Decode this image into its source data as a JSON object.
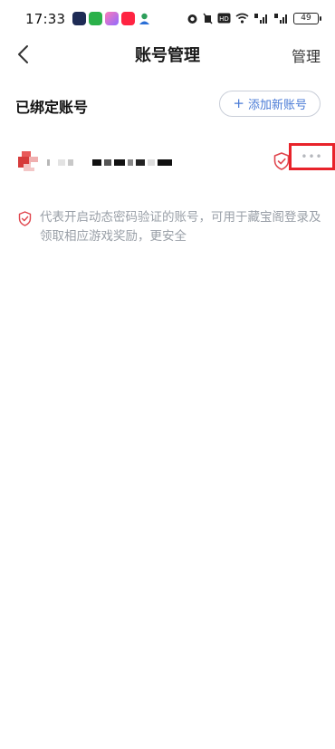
{
  "status_bar": {
    "time": "17:33",
    "battery": "49"
  },
  "nav": {
    "title": "账号管理",
    "manage_label": "管理"
  },
  "section": {
    "title": "已绑定账号",
    "add_button_label": "添加新账号"
  },
  "account": {
    "more_label": "•••"
  },
  "note": {
    "text": "代表开启动态密码验证的账号，可用于藏宝阁登录及领取相应游戏奖励，更安全"
  },
  "colors": {
    "accent_blue": "#4a7bd6",
    "shield_red": "#e0454d",
    "highlight_red": "#e8232a",
    "note_gray": "#9aa0a8"
  },
  "icons": {
    "back": "chevron-left-icon",
    "add": "plus-icon",
    "verified": "shield-check-icon",
    "more": "ellipsis-icon"
  }
}
